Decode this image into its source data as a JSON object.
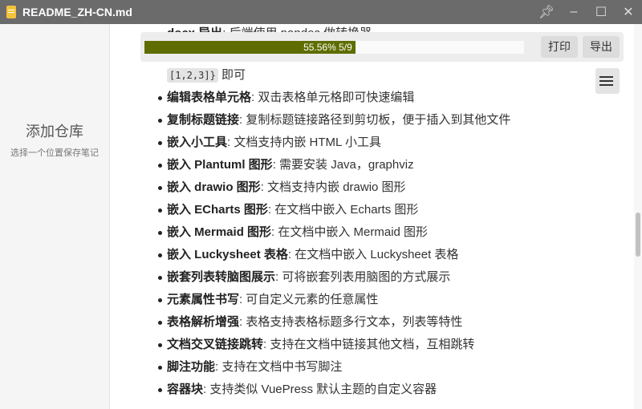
{
  "window": {
    "title": "README_ZH-CN.md"
  },
  "sidebar": {
    "add_repo": "添加仓库",
    "hint": "选择一个位置保存笔记"
  },
  "toolbar": {
    "progress_label": "55.56% 5/9",
    "progress_percent": 55.56,
    "print": "打印",
    "export": "导出"
  },
  "doc": {
    "partial_top": {
      "title": "docx 导出",
      "desc": "后端使用 pandoc 做转换器"
    },
    "partial_code_tail": "[1,2,3]}",
    "partial_code_suffix": "即可",
    "items": [
      {
        "title": "编辑表格单元格",
        "desc": ": 双击表格单元格即可快速编辑"
      },
      {
        "title": "复制标题链接",
        "desc": ": 复制标题链接路径到剪切板，便于插入到其他文件"
      },
      {
        "title": "嵌入小工具",
        "desc": ": 文档支持内嵌 HTML 小工具"
      },
      {
        "title": "嵌入 Plantuml 图形",
        "desc": ": 需要安装 Java，graphviz"
      },
      {
        "title": "嵌入 drawio 图形",
        "desc": ": 文档支持内嵌 drawio 图形"
      },
      {
        "title": "嵌入 ECharts 图形",
        "desc": ": 在文档中嵌入 Echarts 图形"
      },
      {
        "title": "嵌入 Mermaid 图形",
        "desc": ": 在文档中嵌入 Mermaid 图形"
      },
      {
        "title": "嵌入 Luckysheet 表格",
        "desc": ": 在文档中嵌入 Luckysheet 表格"
      },
      {
        "title": "嵌套列表转脑图展示",
        "desc": ": 可将嵌套列表用脑图的方式展示"
      },
      {
        "title": "元素属性书写",
        "desc": ": 可自定义元素的任意属性"
      },
      {
        "title": "表格解析增强",
        "desc": ": 表格支持表格标题多行文本，列表等特性"
      },
      {
        "title": "文档交叉链接跳转",
        "desc": ": 支持在文档中链接其他文档，互相跳转"
      },
      {
        "title": "脚注功能",
        "desc": ": 支持在文档中书写脚注"
      },
      {
        "title": "容器块",
        "desc": ": 支持类似 VuePress 默认主题的自定义容器"
      }
    ]
  }
}
